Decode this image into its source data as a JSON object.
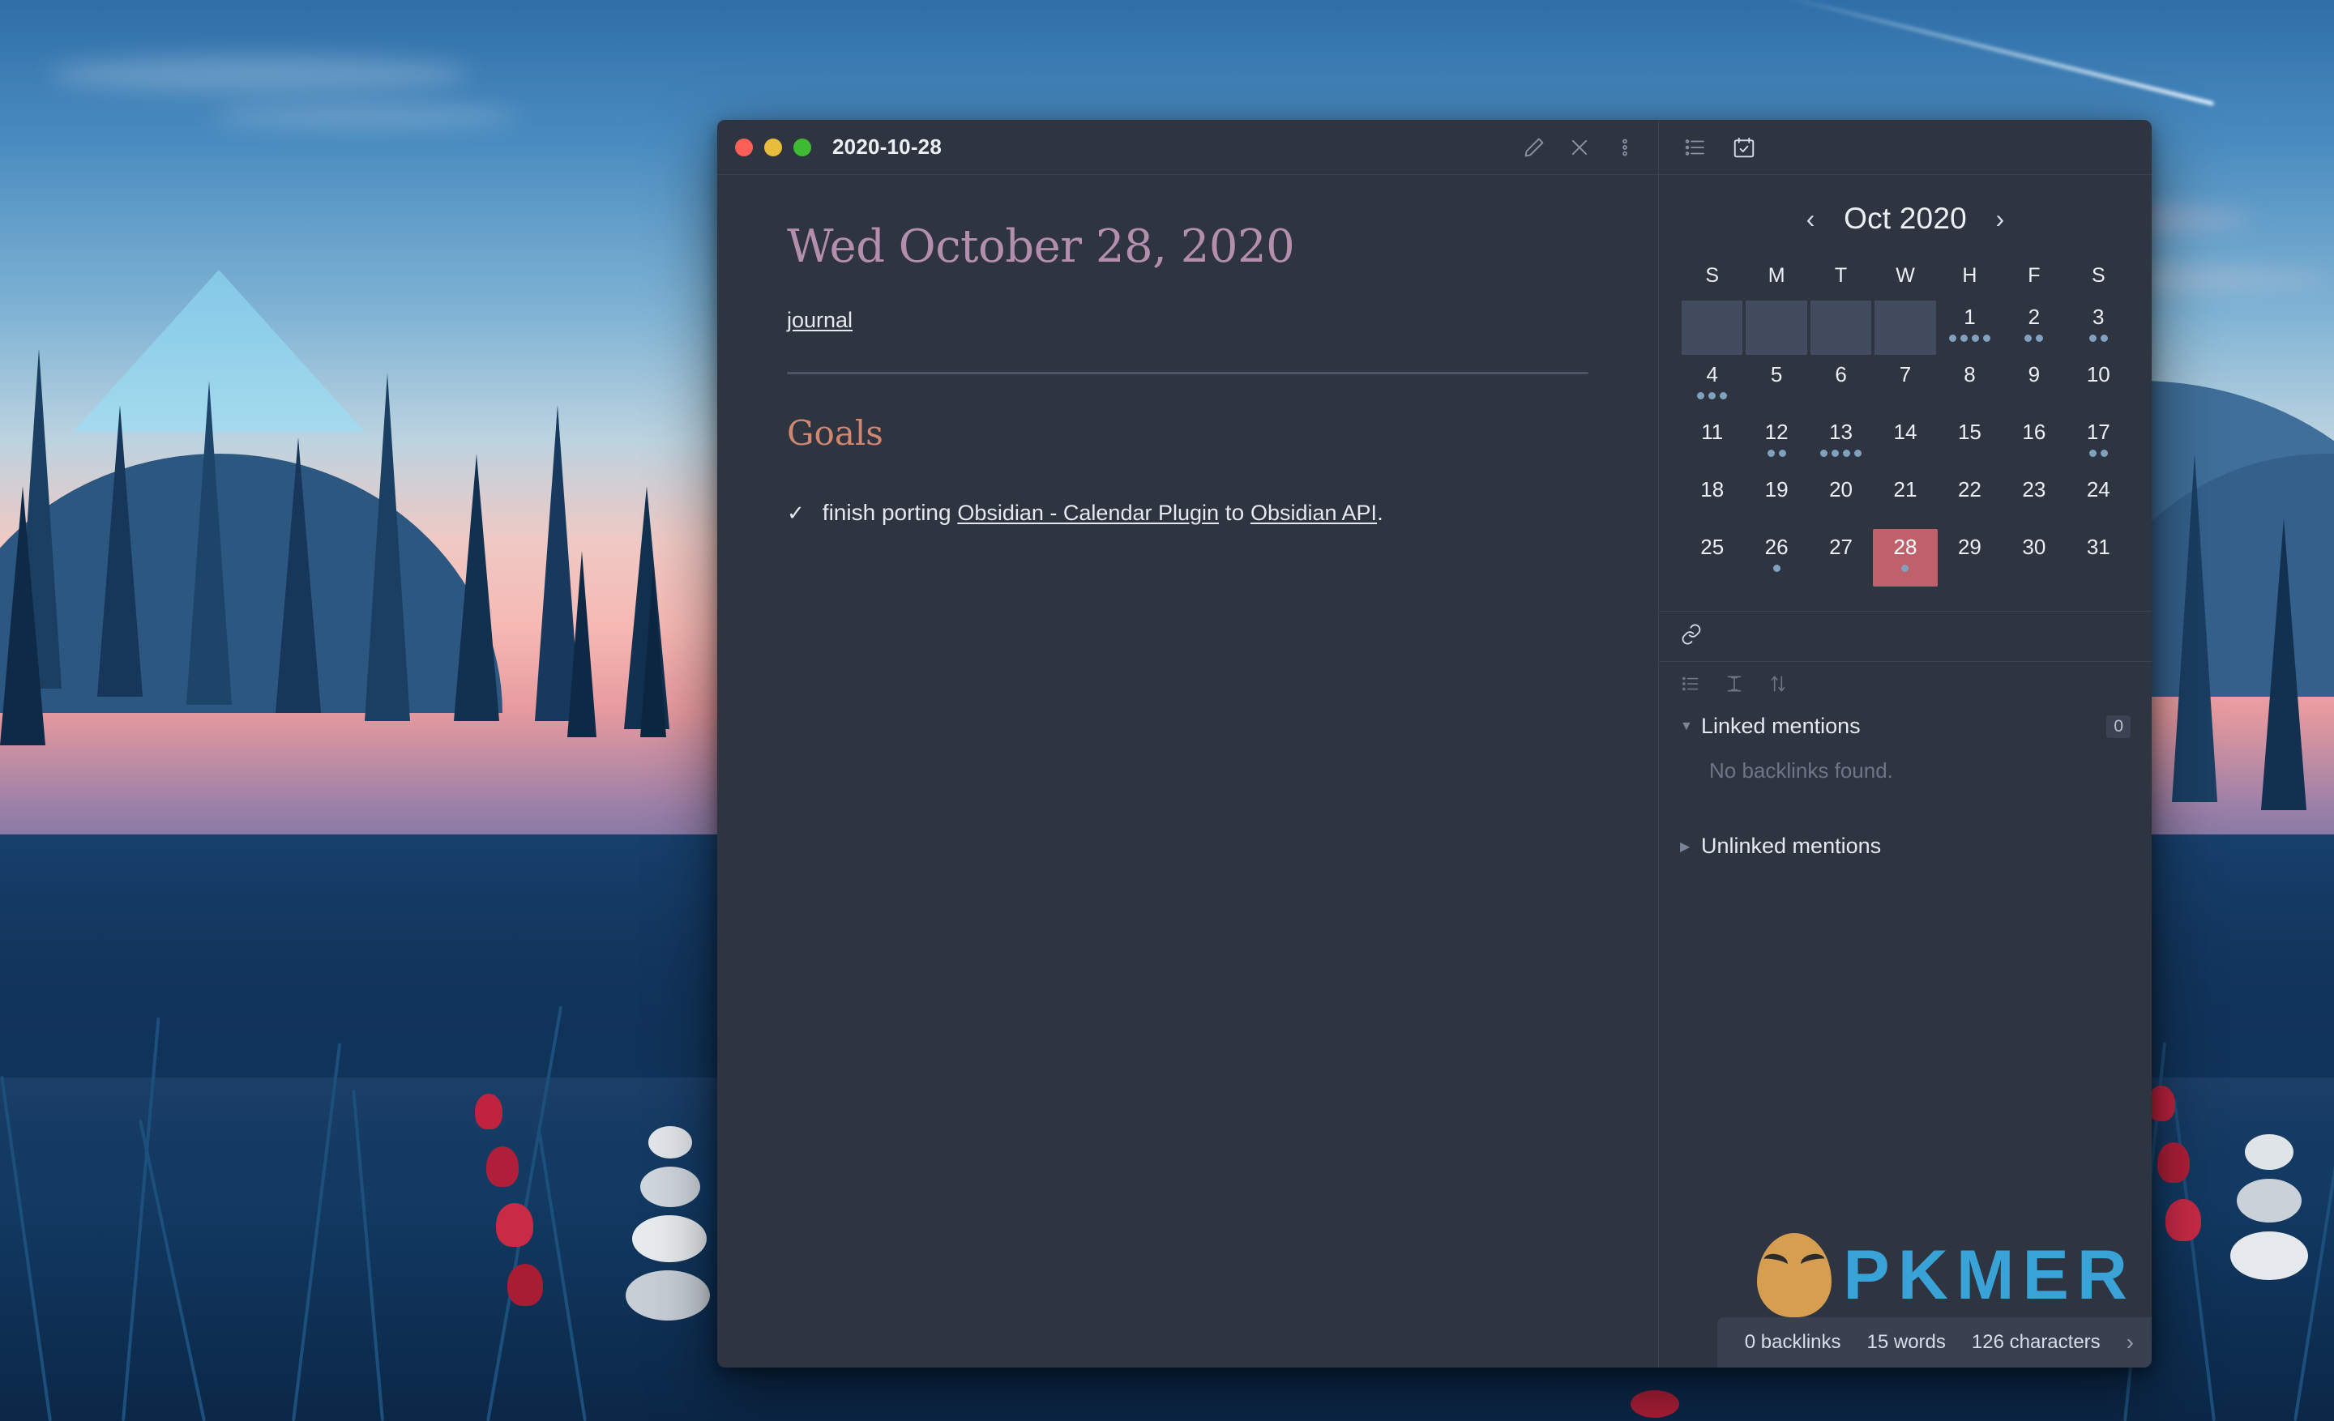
{
  "window": {
    "title": "2020-10-28",
    "traffic_lights": [
      "close",
      "minimize",
      "maximize"
    ],
    "actions": [
      {
        "name": "edit-pencil-icon",
        "label": "Edit"
      },
      {
        "name": "close-icon",
        "label": "Close"
      },
      {
        "name": "more-options-icon",
        "label": "More options"
      }
    ]
  },
  "note": {
    "heading": "Wed October 28, 2020",
    "tag": "journal",
    "section_heading": "Goals",
    "tasks": [
      {
        "check": "✓",
        "prefix": "finish porting ",
        "link1": "Obsidian - Calendar Plugin",
        "middle": " to ",
        "link2": "Obsidian API",
        "suffix": "."
      }
    ]
  },
  "sidebar": {
    "tabs": [
      {
        "name": "outline-icon",
        "label": "Outline"
      },
      {
        "name": "calendar-icon",
        "label": "Calendar"
      }
    ],
    "calendar": {
      "prev_label": "‹",
      "next_label": "›",
      "title": "Oct 2020",
      "weekdays": [
        "S",
        "M",
        "T",
        "W",
        "H",
        "F",
        "S"
      ],
      "leading_blanks": 4,
      "days": [
        {
          "n": 1,
          "dots": 4
        },
        {
          "n": 2,
          "dots": 2
        },
        {
          "n": 3,
          "dots": 2
        },
        {
          "n": 4,
          "dots": 3
        },
        {
          "n": 5,
          "dots": 0
        },
        {
          "n": 6,
          "dots": 0
        },
        {
          "n": 7,
          "dots": 0
        },
        {
          "n": 8,
          "dots": 0
        },
        {
          "n": 9,
          "dots": 0
        },
        {
          "n": 10,
          "dots": 0
        },
        {
          "n": 11,
          "dots": 0
        },
        {
          "n": 12,
          "dots": 2
        },
        {
          "n": 13,
          "dots": 4
        },
        {
          "n": 14,
          "dots": 0
        },
        {
          "n": 15,
          "dots": 0
        },
        {
          "n": 16,
          "dots": 0
        },
        {
          "n": 17,
          "dots": 2
        },
        {
          "n": 18,
          "dots": 0
        },
        {
          "n": 19,
          "dots": 0
        },
        {
          "n": 20,
          "dots": 0
        },
        {
          "n": 21,
          "dots": 0
        },
        {
          "n": 22,
          "dots": 0
        },
        {
          "n": 23,
          "dots": 0
        },
        {
          "n": 24,
          "dots": 0
        },
        {
          "n": 25,
          "dots": 0
        },
        {
          "n": 26,
          "dots": 1
        },
        {
          "n": 27,
          "dots": 0
        },
        {
          "n": 28,
          "dots": 1,
          "today": true
        },
        {
          "n": 29,
          "dots": 0
        },
        {
          "n": 30,
          "dots": 0
        },
        {
          "n": 31,
          "dots": 0
        }
      ]
    },
    "backlinks": {
      "pane_icon": "link-icon",
      "toolbar": [
        {
          "name": "collapse-results-icon",
          "label": "Collapse results"
        },
        {
          "name": "show-more-context-icon",
          "label": "Show more context"
        },
        {
          "name": "change-sort-order-icon",
          "label": "Change sort order"
        }
      ],
      "linked_label": "Linked mentions",
      "linked_count": "0",
      "empty_text": "No backlinks found.",
      "unlinked_label": "Unlinked mentions"
    }
  },
  "statusbar": {
    "backlinks": "0 backlinks",
    "words": "15 words",
    "characters": "126 characters",
    "chevron": "›"
  },
  "watermark": {
    "text": "PKMER"
  },
  "colors": {
    "window_bg": "#2e3440",
    "divider": "#3b4252",
    "empty_cell": "#434c5e",
    "today_bg": "#bf616a",
    "dot": "#81a1c1",
    "h1": "#b48ead",
    "h2": "#d08770",
    "text": "#e5e9f0",
    "muted": "#6d7689"
  }
}
